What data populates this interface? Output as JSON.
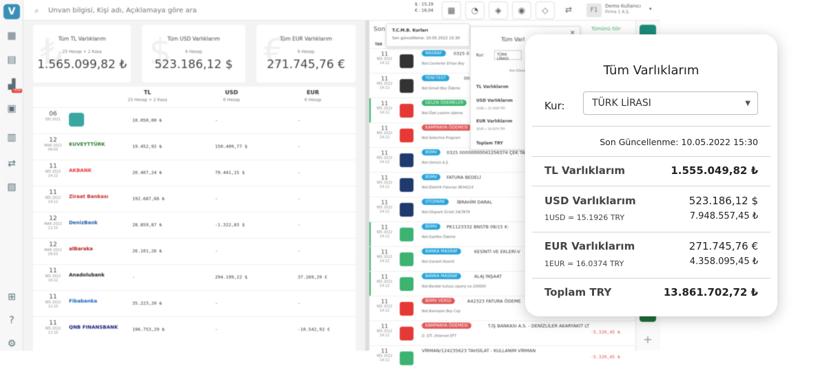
{
  "app": {
    "logo": "V"
  },
  "sidebar": {
    "icons": [
      "dashboard-icon",
      "invoice-icon",
      "chart-icon",
      "ledger-icon",
      "pos-icon",
      "exchange-icon",
      "report-icon",
      "gift-icon",
      "help-icon",
      "settings-icon"
    ],
    "badge": "YENİ"
  },
  "topbar": {
    "search_placeholder": "Ünvan bilgisi, Kişi adı, Açıklamaya göre ara",
    "rates": {
      "usd": "$ : 15,19",
      "eur": "€ : 16,04"
    },
    "user": {
      "avatar": "F1",
      "name": "Demo Kullanıcı",
      "firm": "Firma 1 A.Ş."
    }
  },
  "summary": [
    {
      "title": "Tüm TL Varlıklarım",
      "sub": "25 Hesap + 2 Kasa",
      "value": "1.565.099,82 ₺",
      "watermark": "₺"
    },
    {
      "title": "Tüm USD Varlıklarım",
      "sub": "6 Hesap",
      "value": "523.186,12 $",
      "watermark": "$"
    },
    {
      "title": "Tüm EUR Varlıklarım",
      "sub": "6 Hesap",
      "value": "271.745,76 €",
      "watermark": "€"
    }
  ],
  "assets": {
    "columns": [
      {
        "label": "TL",
        "sub": "25 Hesap + 2 Kasa"
      },
      {
        "label": "USD",
        "sub": "6 Hesap"
      },
      {
        "label": "EUR",
        "sub": "6 Hesap"
      }
    ],
    "rows": [
      {
        "day": "06",
        "month": "EKİ 2021",
        "time": "",
        "bank": "",
        "bank_color": "#3aa6a0",
        "tl": "10.050,00 ₺",
        "usd": "-",
        "eur": "-"
      },
      {
        "day": "12",
        "month": "MAR 2022",
        "time": "09:55",
        "bank": "KUVEYTTÜRK",
        "bank_color": "#2e7d32",
        "tl": "19.452,92 ₺",
        "usd": "150.409,77 $",
        "eur": "-"
      },
      {
        "day": "11",
        "month": "NİS 2022",
        "time": "14:12",
        "bank": "AKBANK",
        "bank_color": "#e53935",
        "tl": "20.407,24 ₺",
        "usd": "79.441,15 $",
        "eur": "-"
      },
      {
        "day": "11",
        "month": "NİS 2022",
        "time": "14:12",
        "bank": "Ziraat Bankası",
        "bank_color": "#c62828",
        "tl": "192.687,66 ₺",
        "usd": "-",
        "eur": "-"
      },
      {
        "day": "12",
        "month": "MAR 2022",
        "time": "12:15",
        "bank": "DenizBank",
        "bank_color": "#1e5aa8",
        "tl": "28.859,87 ₺",
        "usd": "-1.322,83 $",
        "eur": "-"
      },
      {
        "day": "12",
        "month": "MAR 2022",
        "time": "09:55",
        "bank": "alBaraka",
        "bank_color": "#b71c1c",
        "tl": "26.101,26 ₺",
        "usd": "-",
        "eur": "-"
      },
      {
        "day": "11",
        "month": "NİS 2022",
        "time": "14:12",
        "bank": "Anadolubank",
        "bank_color": "#222222",
        "tl": "-",
        "usd": "294.199,22 $",
        "eur": "37.269,29 €"
      },
      {
        "day": "11",
        "month": "NİS 2022",
        "time": "12:10",
        "bank": "Fibabanka",
        "bank_color": "#1565c0",
        "tl": "35.223,20 ₺",
        "usd": "-",
        "eur": "-"
      },
      {
        "day": "11",
        "month": "NİS 2022",
        "time": "12:10",
        "bank": "QNB FINANSBANK",
        "bank_color": "#1a237e",
        "tl": "196.753,29 ₺",
        "usd": "-",
        "eur": "-10.542,92 €"
      }
    ]
  },
  "transactions": {
    "heading": "Son",
    "column_head": "TAR",
    "see_all": "Tümünü Gör",
    "rows": [
      {
        "day": "11",
        "month": "NİS 2022",
        "time": "14:12",
        "icon_color": "#333333",
        "tag": "MASRAF",
        "tag_color": "#29a3d9",
        "desc": "0325 0",
        "note": "Not:Cevherler Erhan Bey",
        "amount": "",
        "bar": false
      },
      {
        "day": "11",
        "month": "NİS 2022",
        "time": "14:12",
        "icon_color": "#333333",
        "tag": "YENİ-TEST",
        "tag_color": "#29a3d9",
        "desc": "00003",
        "note": "Not:İsmail Bey Ödeme",
        "amount": "",
        "bar": false
      },
      {
        "day": "11",
        "month": "NİS 2022",
        "time": "14:12",
        "icon_color": "#e53935",
        "tag": "GELEN ÖDEMELER",
        "tag_color": "#3cb371",
        "desc": "T LTD ŞTİ.",
        "note": "Not:Özel yazılım ödeme",
        "amount": "",
        "bar": true
      },
      {
        "day": "11",
        "month": "NİS 2022",
        "time": "14:12",
        "icon_color": "#e53935",
        "tag": "KAMPANYA ÖDEMESİ",
        "tag_color": "#e05a5a",
        "desc": "",
        "note": "Not:Selective Program",
        "amount": "",
        "bar": false
      },
      {
        "day": "11",
        "month": "NİS 2022",
        "time": "14:12",
        "icon_color": "#1e3a6e",
        "tag": "BSMV",
        "tag_color": "#29a3d9",
        "desc": "0325 00000000041256374 ÇEK TAHSİL",
        "note": "Not:Vomsis A.Ş.",
        "amount": "",
        "bar": false
      },
      {
        "day": "11",
        "month": "NİS 2022",
        "time": "14:12",
        "icon_color": "#1e3a6e",
        "tag": "BSMV",
        "tag_color": "#29a3d9",
        "desc": "FATURA BEDELİ",
        "note": "Not:Elektrik Faturası 9834214",
        "amount": "",
        "bar": false
      },
      {
        "day": "11",
        "month": "NİS 2022",
        "time": "14:12",
        "icon_color": "#1e3a6e",
        "tag": "OTOPARK",
        "tag_color": "#29a3d9",
        "desc": "İBRAHİM DARAL",
        "note": "Not:Otopark Ücreti 34LTA79",
        "amount": "",
        "bar": false
      },
      {
        "day": "11",
        "month": "NİS 2022",
        "time": "14:12",
        "icon_color": "#3cb371",
        "tag": "BSMV",
        "tag_color": "#29a3d9",
        "desc": "PK1123332 BNSTB 08/15 K:",
        "note": "Not:Gazifex Ödeme",
        "amount": "",
        "bar": true
      },
      {
        "day": "11",
        "month": "NİS 2022",
        "time": "14:12",
        "icon_color": "#3cb371",
        "tag": "BANKA MASRAF",
        "tag_color": "#29a3d9",
        "desc": "KESİNTİ VE EKLERİ-V",
        "note": "Not:Garanti Kesinti",
        "amount": "",
        "bar": true
      },
      {
        "day": "11",
        "month": "NİS 2022",
        "time": "14:12",
        "icon_color": "#3cb371",
        "tag": "BANKA MASRAF",
        "tag_color": "#29a3d9",
        "desc": "ALAJ İNŞAAT",
        "note": "Not:Bardak kutusu sipariş no 100000",
        "amount": "",
        "bar": true
      },
      {
        "day": "11",
        "month": "NİS 2022",
        "time": "14:12",
        "icon_color": "#e53935",
        "tag": "BSMV VERGİ",
        "tag_color": "#e05a5a",
        "desc": "A42323 FATURA ÖDEME",
        "note": "Not:Ramazan Bey Cep",
        "amount": "",
        "bar": false
      },
      {
        "day": "11",
        "month": "NİS 2022",
        "time": "14:12",
        "icon_color": "#e53935",
        "tag": "KAMPANYA ÖDEMESİ",
        "tag_color": "#e05a5a",
        "desc": "T.İŞ BANKASI A.S. - DENİZLİLER AKARYAKIT LT",
        "note": "D. ŞTİ. /İnternet EFT",
        "amount": "-5.320,45 ₺",
        "bar": false
      },
      {
        "day": "11",
        "month": "NİS 2022",
        "time": "14:12",
        "icon_color": "#3cb371",
        "tag": "",
        "tag_color": "#29a3d9",
        "desc": "VİRMAN/124235623 TAHSİLAT - KULLANIM VİRMAN",
        "note": "",
        "amount": "-5.320,45 ₺",
        "bar": false
      }
    ]
  },
  "tcmb": {
    "title": "T.C.M.B. Kurları",
    "updated": "Son güncellleme: 10.05.2022 15:30"
  },
  "mini_panel": {
    "title": "Tüm Varl",
    "kur": "Kur:",
    "currency": "TÜRK LİRASI",
    "updated": "Son Güncel",
    "rows": [
      "TL Varlıklarım",
      "USD Varlıklarım",
      "EUR Varlıklarım",
      "Toplam TRY"
    ],
    "subs": [
      "1USD = 15.1926 TRY",
      "1EUR = 16.0374 TRY"
    ]
  },
  "panel": {
    "title": "Tüm Varlıklarım",
    "kur_label": "Kur:",
    "currency": "TÜRK LİRASI",
    "updated": "Son Güncellenme: 10.05.2022 15:30",
    "tl_label": "TL Varlıklarım",
    "tl_value": "1.555.049,82 ₺",
    "usd_label": "USD Varlıklarım",
    "usd_value": "523.186,12 $",
    "usd_rate": "1USD = 15.1926 TRY",
    "usd_converted": "7.948.557,45 ₺",
    "eur_label": "EUR Varlıklarım",
    "eur_value": "271.745,76 €",
    "eur_rate": "1EUR = 16.0374 TRY",
    "eur_converted": "4.358.095,45 ₺",
    "total_label": "Toplam TRY",
    "total_value": "13.861.702,72 ₺"
  }
}
